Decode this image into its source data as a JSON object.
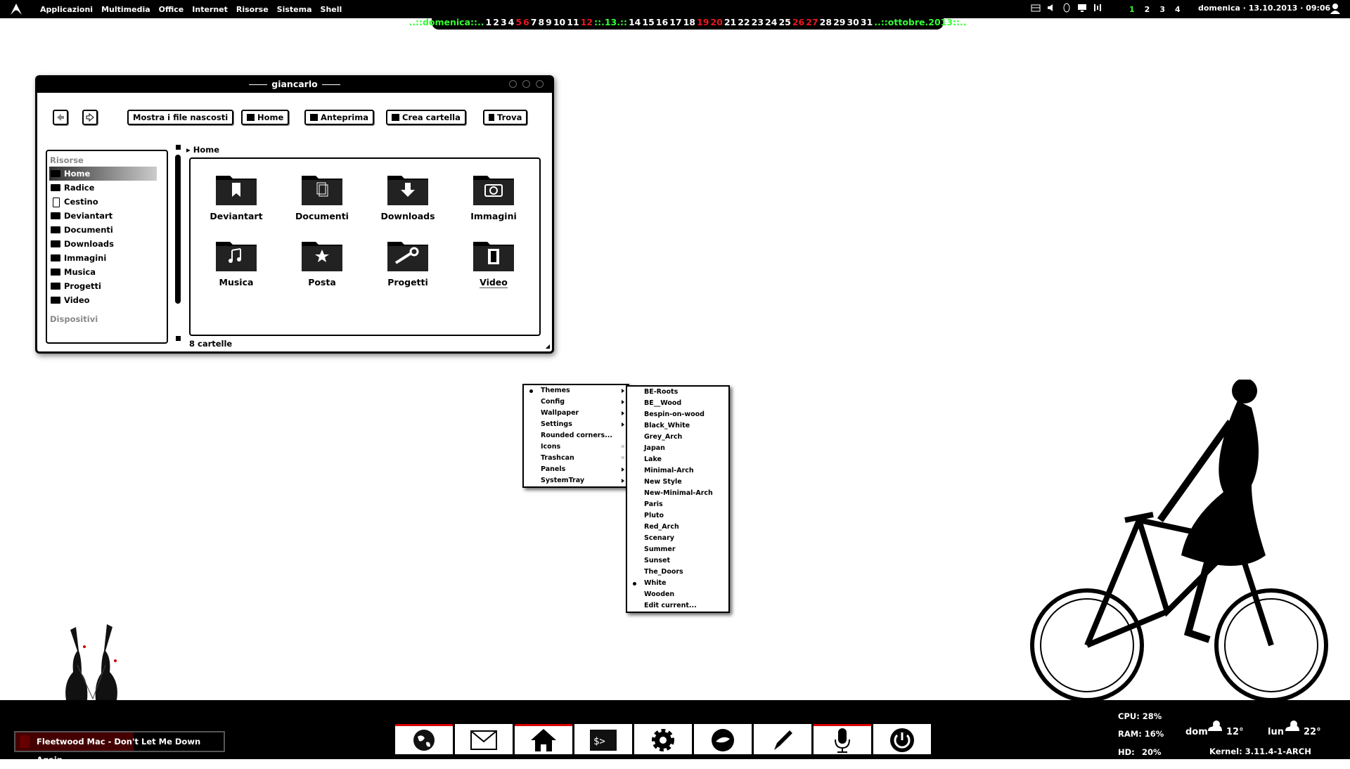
{
  "topbar": {
    "menu": [
      "Applicazioni",
      "Multimedia",
      "Office",
      "Internet",
      "Risorse",
      "Sistema",
      "Shell"
    ],
    "desktops": [
      "1",
      "2",
      "3",
      "4"
    ],
    "clock": "domenica  ·  13.10.2013  ·  09:06"
  },
  "calendar": {
    "day_label": "..::domenica::..",
    "days_a": [
      "1",
      "2",
      "3",
      "4"
    ],
    "days_a_red": [
      "5",
      "6"
    ],
    "days_b": [
      "7",
      "8",
      "9",
      "10",
      "11"
    ],
    "days_b_red": [
      "12"
    ],
    "today": "::.13.::",
    "days_c": [
      "14",
      "15",
      "16",
      "17",
      "18"
    ],
    "days_c_red": [
      "19",
      "20"
    ],
    "days_d": [
      "21",
      "22",
      "23",
      "24",
      "25"
    ],
    "days_d_red": [
      "26",
      "27"
    ],
    "days_e": [
      "28",
      "29",
      "30",
      "31"
    ],
    "month_label": "..::ottobre.2013::.."
  },
  "file_manager": {
    "title": "giancarlo",
    "toolbar": {
      "hidden": "Mostra i file nascosti",
      "home": "Home",
      "preview": "Anteprima",
      "new_folder": "Crea cartella",
      "find": "Trova"
    },
    "sidebar": {
      "resources_header": "Risorse",
      "items": [
        "Home",
        "Radice",
        "Cestino",
        "Deviantart",
        "Documenti",
        "Downloads",
        "Immagini",
        "Musica",
        "Progetti",
        "Video"
      ],
      "devices_header": "Dispositivi"
    },
    "breadcrumb": "Home",
    "folders": [
      {
        "label": "Deviantart",
        "icon": "bookmark-icon"
      },
      {
        "label": "Documenti",
        "icon": "documents-icon"
      },
      {
        "label": "Downloads",
        "icon": "download-icon"
      },
      {
        "label": "Immagini",
        "icon": "camera-icon"
      },
      {
        "label": "Musica",
        "icon": "music-icon"
      },
      {
        "label": "Posta",
        "icon": "star-icon"
      },
      {
        "label": "Progetti",
        "icon": "wrench-icon"
      },
      {
        "label": "Video",
        "icon": "film-icon"
      }
    ],
    "status": "8 cartelle"
  },
  "context_menu": {
    "items": [
      "Themes",
      "Config",
      "Wallpaper",
      "Settings",
      "Rounded corners...",
      "Icons",
      "Trashcan",
      "Panels",
      "SystemTray"
    ]
  },
  "themes_menu": {
    "items": [
      "BE-Roots",
      "BE__Wood",
      "Bespin-on-wood",
      "Black_White",
      "Grey_Arch",
      "Japan",
      "Lake",
      "Minimal-Arch",
      "New Style",
      "New-Minimal-Arch",
      "Paris",
      "Pluto",
      "Red_Arch",
      "Scenary",
      "Summer",
      "Sunset",
      "The_Doors",
      "White",
      "Wooden",
      "Edit current..."
    ],
    "selected": "White"
  },
  "now_playing": "Fleetwood Mac - Don't Let Me Down Again",
  "dock": [
    "globe-icon",
    "mail-icon",
    "home-icon",
    "terminal-icon",
    "gear-icon",
    "cloud-icon",
    "pen-icon",
    "microphone-icon",
    "power-icon"
  ],
  "stats": {
    "cpu": "CPU: 28%",
    "ram": "RAM: 16%",
    "hd_label": "HD:",
    "hd_value": "20%",
    "kernel": "Kernel: 3.11.4-1-ARCH"
  },
  "weather": {
    "day1": "dom",
    "temp1": "12°",
    "day2": "lun",
    "temp2": "22°"
  },
  "colors": {
    "accent_green": "#33ff33",
    "accent_red": "#e8181f"
  }
}
